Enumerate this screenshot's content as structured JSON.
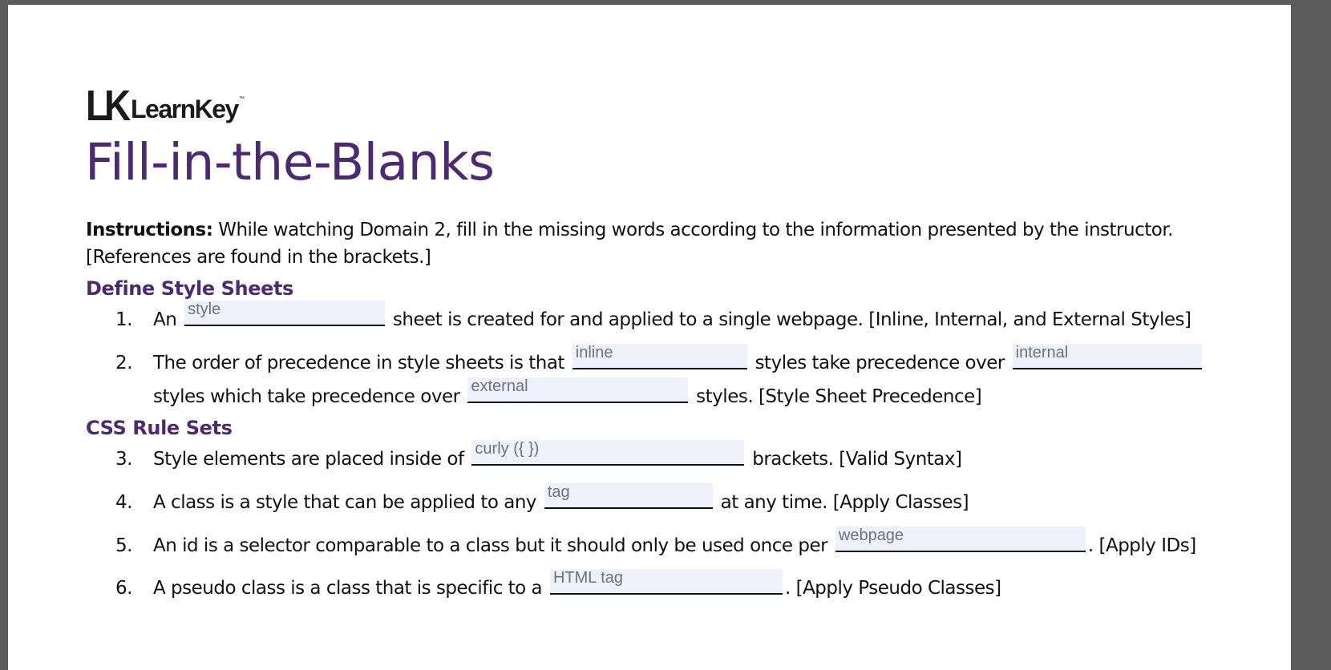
{
  "logo": {
    "mark": "LK",
    "text": "LearnKey",
    "tm": "™"
  },
  "title": "Fill-in-the-Blanks",
  "instructions": {
    "label": "Instructions:",
    "text": " While watching Domain 2, fill in the missing words according to the information presented by the instructor. [References are found in the brackets.]"
  },
  "sections": [
    {
      "heading": "Define Style Sheets"
    },
    {
      "heading": "CSS Rule Sets"
    }
  ],
  "items": [
    {
      "num": "1.",
      "a": "An ",
      "b1": "style",
      "b": " sheet is created for and applied to a single webpage. [Inline, Internal, and External Styles]"
    },
    {
      "num": "2.",
      "a": "The order of precedence in style sheets is that ",
      "b1": "inline",
      "b": " styles take precedence over ",
      "b2": "internal",
      "c": "styles which take precedence over ",
      "b3": "external",
      "d": " styles. [Style Sheet Precedence]"
    },
    {
      "num": "3.",
      "a": "Style elements are placed inside of ",
      "b1": "curly ({ })",
      "b": " brackets. [Valid Syntax]"
    },
    {
      "num": "4.",
      "a": "A class is a style that can be applied to any ",
      "b1": "tag",
      "b": " at any time. [Apply Classes]"
    },
    {
      "num": "5.",
      "a": "An id is a selector comparable to a class but it should only be used once per ",
      "b1": "webpage",
      "b": ". [Apply IDs]"
    },
    {
      "num": "6.",
      "a": "A pseudo class is a class that is specific to a ",
      "b1": "HTML tag",
      "b": ". [Apply Pseudo Classes]"
    }
  ]
}
